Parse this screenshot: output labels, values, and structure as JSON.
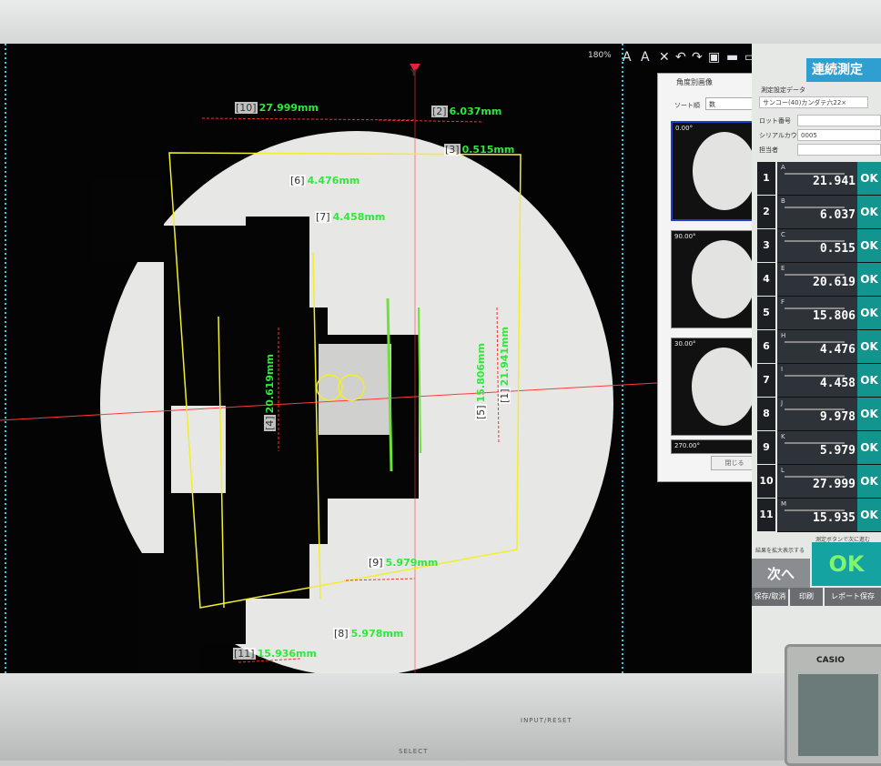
{
  "toolbar": {
    "zoom": "180%",
    "icons": [
      "text-icon",
      "text-alt-icon",
      "close-icon",
      "undo-icon",
      "redo-icon",
      "image-icon",
      "save-icon",
      "monitor-icon",
      "crop-icon"
    ]
  },
  "viewer": {
    "y_axis": "Y",
    "measurements": [
      {
        "index": "[10]",
        "value": "27.999mm"
      },
      {
        "index": "[2]",
        "value": "6.037mm"
      },
      {
        "index": "[3]",
        "value": "0.515mm"
      },
      {
        "index": "[6]",
        "value": "4.476mm"
      },
      {
        "index": "[7]",
        "value": "4.458mm"
      },
      {
        "index": "[4]",
        "value": "20.619mm"
      },
      {
        "index": "[5]",
        "value": "15.806mm"
      },
      {
        "index": "[1]",
        "value": "21.941mm"
      },
      {
        "index": "[9]",
        "value": "5.979mm"
      },
      {
        "index": "[8]",
        "value": "5.978mm"
      },
      {
        "index": "[11]",
        "value": "15.936mm"
      }
    ]
  },
  "thumb_panel": {
    "title": "角度別画像",
    "close": "×",
    "sort_label": "ソート順",
    "sort_value": "数",
    "thumbs": [
      "0.00°",
      "90.00°",
      "30.00°",
      "270.00°"
    ],
    "close_button": "閉じる"
  },
  "results": {
    "title": "連続測定",
    "subtitle": "測定設定データ",
    "preset": "サンコー(40)カンダテ六22×",
    "fields": [
      {
        "label": "ロット番号",
        "value": ""
      },
      {
        "label": "シリアルカウンタ",
        "value": "0005"
      },
      {
        "label": "担当者",
        "value": ""
      }
    ],
    "rows": [
      {
        "num": "1",
        "letter": "A",
        "value": "21.941",
        "status": "OK"
      },
      {
        "num": "2",
        "letter": "B",
        "value": "6.037",
        "status": "OK"
      },
      {
        "num": "3",
        "letter": "C",
        "value": "0.515",
        "status": "OK"
      },
      {
        "num": "4",
        "letter": "E",
        "value": "20.619",
        "status": "OK"
      },
      {
        "num": "5",
        "letter": "F",
        "value": "15.806",
        "status": "OK"
      },
      {
        "num": "6",
        "letter": "H",
        "value": "4.476",
        "status": "OK"
      },
      {
        "num": "7",
        "letter": "I",
        "value": "4.458",
        "status": "OK"
      },
      {
        "num": "8",
        "letter": "J",
        "value": "9.978",
        "status": "OK"
      },
      {
        "num": "9",
        "letter": "K",
        "value": "5.979",
        "status": "OK"
      },
      {
        "num": "10",
        "letter": "L",
        "value": "27.999",
        "status": "OK"
      },
      {
        "num": "11",
        "letter": "M",
        "value": "15.935",
        "status": "OK"
      }
    ],
    "check1": "結果を拡大表示する",
    "check2": "測定ボタンで次に進む",
    "next_button": "次へ",
    "overall": "OK",
    "save_button": "保存/取消",
    "print_button": "印刷",
    "report_button": "レポート保存"
  },
  "monitor": {
    "select_label": "SELECT",
    "input_label": "INPUT/RESET",
    "clock_brand": "CASIO"
  },
  "colors": {
    "accent": "#2f9fd1",
    "ok": "#12948f",
    "measure": "#2ee83a",
    "guide": "#f2ee2a",
    "dim": "#ff2a2a"
  }
}
